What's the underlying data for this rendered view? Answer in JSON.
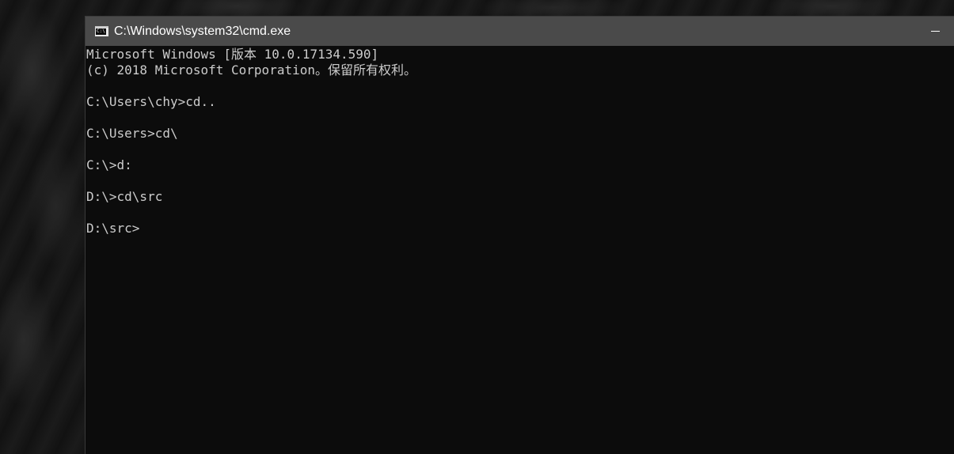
{
  "window": {
    "title": "C:\\Windows\\system32\\cmd.exe",
    "icon": "cmd-icon",
    "icon_text": "C:\\."
  },
  "console": {
    "lines": [
      "Microsoft Windows [版本 10.0.17134.590]",
      "(c) 2018 Microsoft Corporation。保留所有权利。",
      "",
      "C:\\Users\\chy>cd..",
      "",
      "C:\\Users>cd\\",
      "",
      "C:\\>d:",
      "",
      "D:\\>cd\\src",
      "",
      "D:\\src>"
    ]
  },
  "colors": {
    "titlebar": "#4a4a4a",
    "console_background": "#0c0c0c",
    "console_text": "#cccccc"
  }
}
